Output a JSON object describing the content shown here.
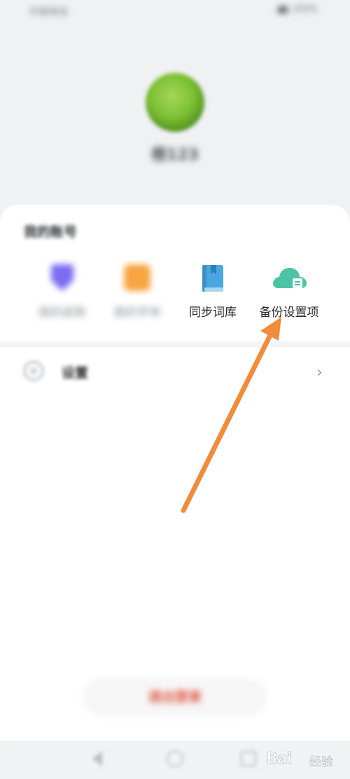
{
  "status_bar": {
    "left_text": "中国电信",
    "right_text": "100%"
  },
  "profile": {
    "username": "橙123"
  },
  "account_section": {
    "title": "我的账号",
    "items": [
      {
        "label": "我的皮肤",
        "icon": "shield-icon",
        "color": "#7b6cf0"
      },
      {
        "label": "我的字体",
        "icon": "font-icon",
        "color": "#f7a541"
      },
      {
        "label": "同步词库",
        "icon": "book-icon",
        "color": "#4aa6e0"
      },
      {
        "label": "备份设置项",
        "icon": "cloud-icon",
        "color": "#4cc2a7"
      }
    ]
  },
  "settings": {
    "label": "设置",
    "icon": "gear-icon"
  },
  "logout": {
    "label": "退出登录",
    "color": "#e0533f"
  },
  "nav": {
    "back_icon": "back-triangle-icon",
    "home_icon": "home-circle-icon",
    "recent_icon": "recent-square-icon"
  },
  "watermark": {
    "brand": "Bai",
    "suffix": "经验"
  },
  "annotation": {
    "arrow_color": "#f08c3a"
  }
}
